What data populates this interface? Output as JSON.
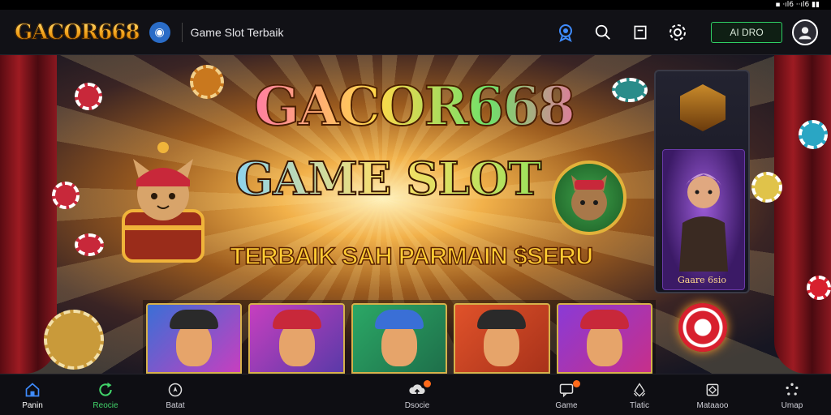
{
  "status_bar": {
    "text": "▪ ·ıl6 ··ıl6 ▮▮"
  },
  "header": {
    "logo_text": "GACOR668",
    "subtitle": "Game Slot Terbaik",
    "login_label": "AI DRO",
    "icons": [
      "award-icon",
      "search-icon",
      "bookmark-icon",
      "settings-icon"
    ]
  },
  "banner": {
    "title": "GACOR668",
    "subtitle": "GAME SLOT",
    "tagline": "TERBAIK SAH PARMAIN $SERU",
    "side_card_label": "Gaare 6sio",
    "game_cards": [
      {
        "colors": [
          "#3a6fd6",
          "#c73fbf"
        ]
      },
      {
        "colors": [
          "#c73fbf",
          "#5a3aa8"
        ]
      },
      {
        "colors": [
          "#2ba866",
          "#1e6f4a"
        ]
      },
      {
        "colors": [
          "#e0522a",
          "#a8321a"
        ]
      },
      {
        "colors": [
          "#8a3ad6",
          "#c72f8a"
        ]
      }
    ]
  },
  "bottom_nav": {
    "items": [
      {
        "label": "Panin",
        "icon": "home-icon",
        "state": "active"
      },
      {
        "label": "Reocie",
        "icon": "refresh-icon",
        "state": "green"
      },
      {
        "label": "Batat",
        "icon": "compass-icon",
        "state": "normal"
      },
      {
        "label": "Dsocie",
        "icon": "cloud-upload-icon",
        "state": "normal",
        "badge": true
      },
      {
        "label": "Game",
        "icon": "chat-icon",
        "state": "normal",
        "badge": true
      },
      {
        "label": "Tlatic",
        "icon": "recycle-icon",
        "state": "normal"
      },
      {
        "label": "Mataaoo",
        "icon": "layers-icon",
        "state": "normal"
      },
      {
        "label": "Umap",
        "icon": "dots-circle-icon",
        "state": "normal"
      }
    ]
  }
}
